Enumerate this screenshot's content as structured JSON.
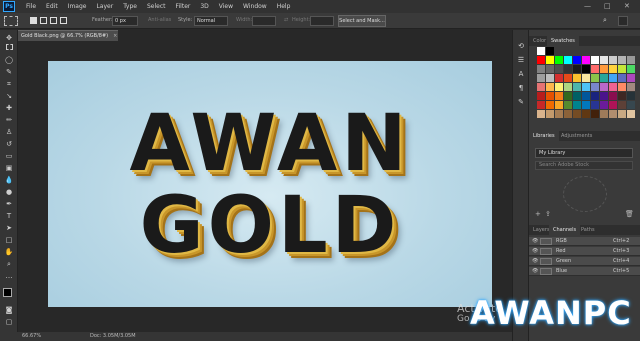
{
  "app": {
    "logo": "Ps"
  },
  "menus": [
    "File",
    "Edit",
    "Image",
    "Layer",
    "Type",
    "Select",
    "Filter",
    "3D",
    "View",
    "Window",
    "Help"
  ],
  "window_controls": {
    "minimize": "—",
    "maximize": "□",
    "close": "✕"
  },
  "options_bar": {
    "feather_label": "Feather:",
    "feather_value": "0 px",
    "antialias_label": "Anti-alias",
    "style_label": "Style:",
    "style_value": "Normal",
    "width_label": "Width:",
    "height_label": "Height:",
    "select_mask_button": "Select and Mask..."
  },
  "document_tab": {
    "title": "Gold Black.png @ 66.7% (RGB/8#)",
    "close": "×"
  },
  "canvas": {
    "line1": "AWAN",
    "line2": "GOLD"
  },
  "status_bar": {
    "zoom": "66.67%",
    "doc": "Doc: 3.05M/3.05M"
  },
  "panels": {
    "swatches_tabs": [
      "Color",
      "Swatches"
    ],
    "active_swatch_tab": "Swatches",
    "libraries_tabs": [
      "Libraries",
      "Adjustments"
    ],
    "library_select": "My Library",
    "library_search_placeholder": "Search Adobe Stock",
    "layers_tabs": [
      "Layers",
      "Channels",
      "Paths"
    ],
    "channels": [
      {
        "name": "RGB",
        "shortcut": "Ctrl+2"
      },
      {
        "name": "Red",
        "shortcut": "Ctrl+3"
      },
      {
        "name": "Green",
        "shortcut": "Ctrl+4"
      },
      {
        "name": "Blue",
        "shortcut": "Ctrl+5"
      }
    ]
  },
  "overlays": {
    "watermark": "AWANPC",
    "activate_line1": "Activate",
    "activate_line2": "Go to Sy"
  },
  "colors": {
    "accent": "#31a8ff",
    "canvas_bg": "#b9d8e6",
    "gold": "#c8962a"
  }
}
